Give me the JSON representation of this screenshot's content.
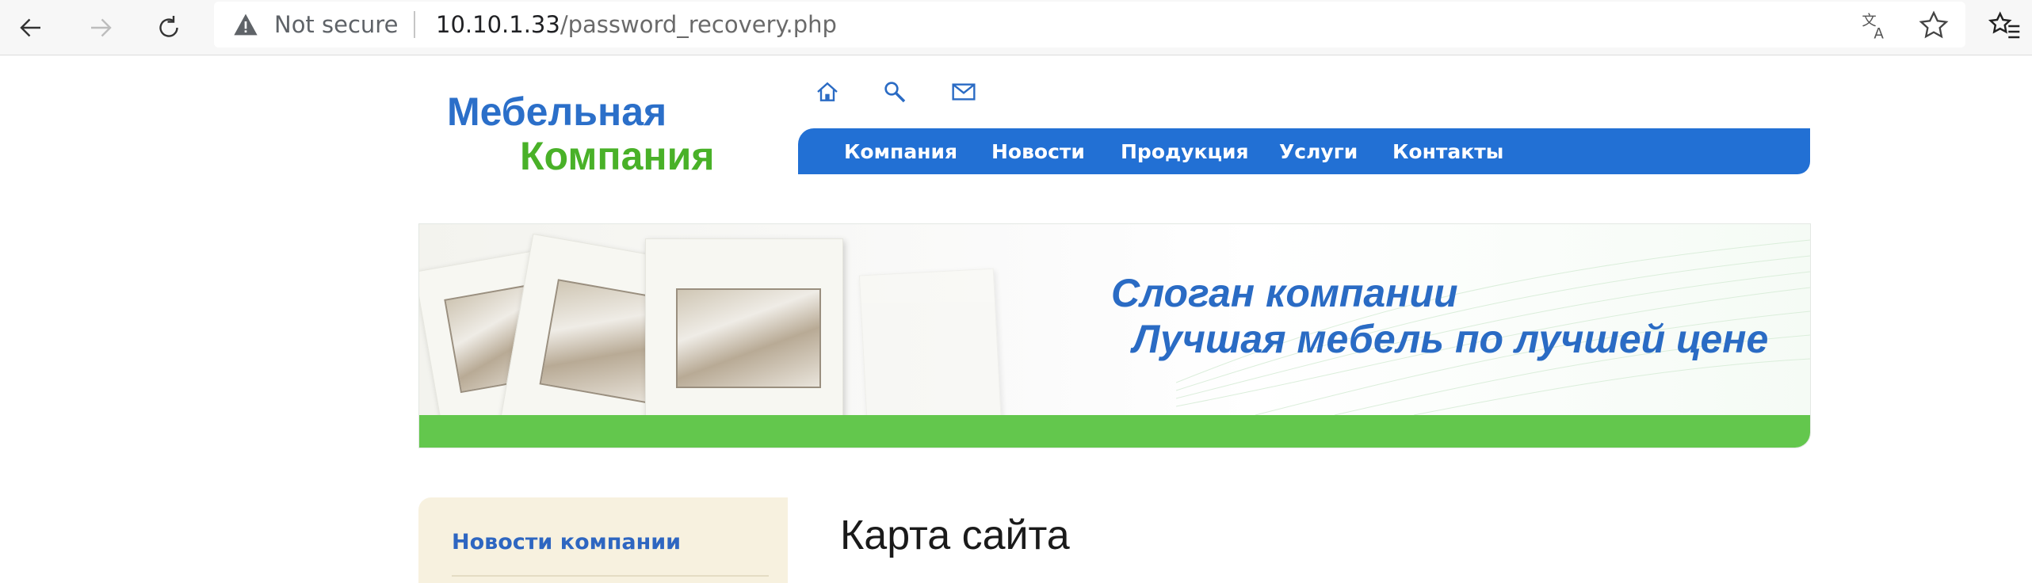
{
  "browser": {
    "security_label": "Not secure",
    "url_host": "10.10.1.33",
    "url_path": "/password_recovery.php",
    "icons": [
      "back-arrow-icon",
      "forward-arrow-icon",
      "reload-icon",
      "warning-icon",
      "translate-icon",
      "star-icon",
      "favorites-icon"
    ]
  },
  "site": {
    "logo": {
      "line1": "Мебельная",
      "line2": "Компания"
    },
    "utility_icons": [
      "home-icon",
      "search-icon",
      "mail-icon"
    ],
    "nav": {
      "items": [
        "Компания",
        "Новости",
        "Продукция",
        "Услуги",
        "Контакты"
      ]
    },
    "banner": {
      "slogan_line1": "Слоган компании",
      "slogan_line2": "Лучшая мебель по лучшей цене"
    },
    "sidebar": {
      "link": "Новости компании"
    },
    "main": {
      "heading": "Карта сайта"
    },
    "colors": {
      "nav_blue": "#2270d4",
      "logo_blue": "#2b6fc9",
      "logo_green": "#49b128",
      "banner_green": "#63c74d",
      "sidebar_bg": "#f7f1df"
    }
  }
}
